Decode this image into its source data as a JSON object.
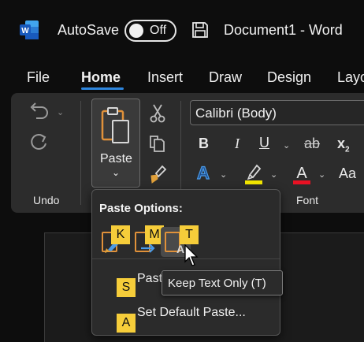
{
  "titlebar": {
    "app_icon": "word-logo-icon",
    "autosave_label": "AutoSave",
    "autosave_state": "Off",
    "save_icon": "save-icon",
    "document_title": "Document1  -  Word"
  },
  "tabs": [
    {
      "label": "File"
    },
    {
      "label": "Home",
      "active": true
    },
    {
      "label": "Insert"
    },
    {
      "label": "Draw"
    },
    {
      "label": "Design"
    },
    {
      "label": "Layo"
    }
  ],
  "ribbon": {
    "undo_group": {
      "label": "Undo",
      "icons": [
        "undo-icon",
        "redo-icon"
      ]
    },
    "clipboard": {
      "paste_label": "Paste",
      "icons": [
        "clipboard-icon",
        "cut-icon",
        "copy-icon",
        "format-painter-icon"
      ]
    },
    "font_group": {
      "label": "Font",
      "font_name": "Calibri (Body)",
      "bold": "B",
      "italic": "I",
      "underline": "U",
      "strikethrough": "ab",
      "subscript": "x",
      "subscript_suffix": "2",
      "text_effects": "A",
      "font_color": "A",
      "change_case": "Aa",
      "highlight_color": "#f2e600",
      "font_color_bar": "#e81123"
    }
  },
  "paste_menu": {
    "header": "Paste Options:",
    "options": [
      {
        "key": "K",
        "icon": "keep-source-formatting-icon"
      },
      {
        "key": "M",
        "icon": "merge-formatting-icon"
      },
      {
        "key": "T",
        "icon": "keep-text-only-icon"
      }
    ],
    "items": [
      {
        "key": "S",
        "label": "Past"
      },
      {
        "key": "A",
        "label": "Set Default Paste..."
      }
    ],
    "tooltip": "Keep Text Only (T)"
  },
  "colors": {
    "accent": "#2e86de",
    "key_badge": "#f6cd3a",
    "ribbon_bg": "#2c2c2c",
    "window_bg": "#0d0d0d"
  }
}
